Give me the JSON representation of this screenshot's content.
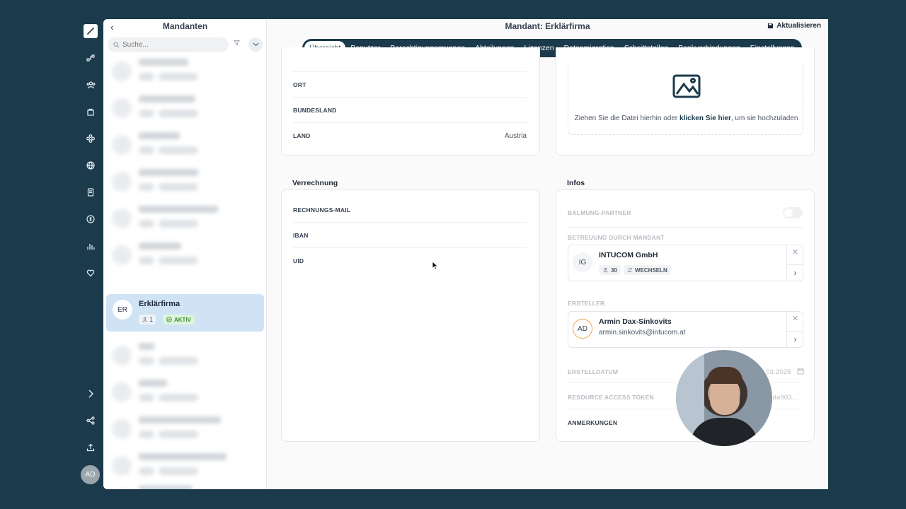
{
  "rail": {
    "avatar": "AD",
    "icons": [
      "logo-icon",
      "workflow-icon",
      "users-icon",
      "bag-icon",
      "modules-icon",
      "globe-icon",
      "document-icon",
      "dollar-icon",
      "bar-chart-icon",
      "heart-icon",
      "expand-icon",
      "share-icon",
      "upload-icon"
    ]
  },
  "list": {
    "title": "Mandanten",
    "back": "‹",
    "search_placeholder": "Suche...",
    "active": {
      "initials": "ER",
      "name": "Erklärfirma",
      "count": "1",
      "status": "AKTIV"
    }
  },
  "main": {
    "title": "Mandant: Erklärfirma",
    "refresh": "Aktualisieren",
    "tabs": [
      "Übersicht",
      "Benutzer",
      "Berechtigungsgruppen",
      "Abteilungen",
      "Lizenzen",
      "Datenmigration",
      "Schnittstellen",
      "Bankverbindungen",
      "Einstellungen"
    ],
    "address": {
      "ort_label": "ORT",
      "ort_value": "",
      "bundesland_label": "BUNDESLAND",
      "bundesland_value": "",
      "land_label": "LAND",
      "land_value": "Austria"
    },
    "upload": {
      "text_before": "Ziehen Sie die Datei hierhin oder ",
      "link": "klicken Sie hier",
      "text_after": ", um sie hochzuladen"
    },
    "billing": {
      "title": "Verrechnung",
      "rows": [
        "RECHNUNGS-MAIL",
        "IBAN",
        "UID"
      ]
    },
    "infos": {
      "title": "Infos",
      "partner_label": "BALMUNG-PARTNER",
      "betreuung_label": "BETREUUNG DURCH MANDANT",
      "betreuung": {
        "initials": "IG",
        "name": "INTUCOM GmbH",
        "count": "30",
        "action": "WECHSELN"
      },
      "ersteller_label": "ERSTELLER",
      "ersteller": {
        "initials": "AD",
        "name": "Armin Dax-Sinkovits",
        "email": "armin.sinkovits@intucom.at"
      },
      "erstelldatum_label": "ERSTELLDATUM",
      "erstelldatum_value": "03.2025",
      "token_label": "RESOURCE ACCESS TOKEN",
      "token_value": "dda903...",
      "anmerkungen_label": "ANMERKUNGEN"
    }
  }
}
